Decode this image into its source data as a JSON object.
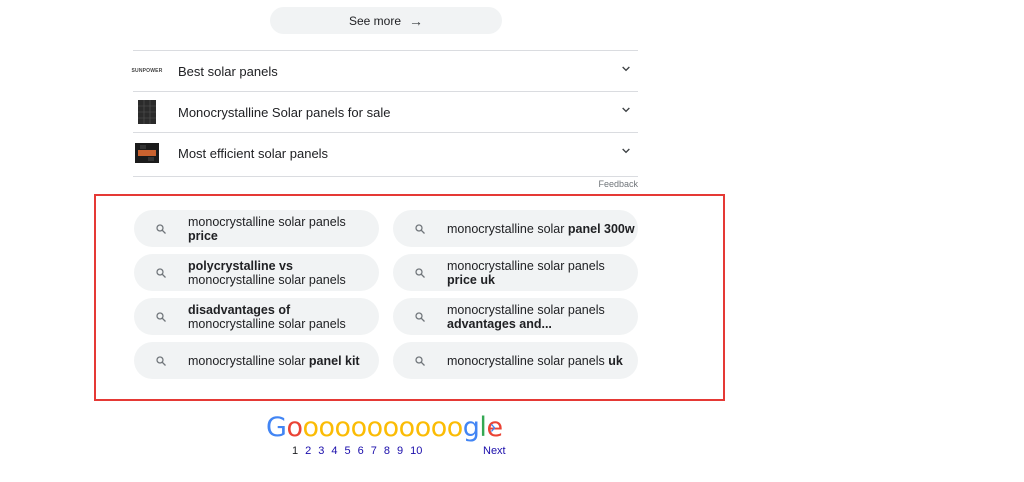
{
  "see_more": {
    "label": "See more",
    "arrow": "→"
  },
  "related_searches": [
    {
      "label": "Best solar panels",
      "thumb": "SUNPOWER",
      "icon": "sunpower-logo-icon"
    },
    {
      "label": "Monocrystalline Solar panels for sale",
      "icon": "solar-panel-thumb-icon"
    },
    {
      "label": "Most efficient solar panels",
      "icon": "solar-panel-efficient-thumb-icon"
    }
  ],
  "feedback": "Feedback",
  "suggestions": [
    {
      "normal": "monocrystalline solar panels ",
      "bold": "price"
    },
    {
      "normal": "monocrystalline solar ",
      "bold": "panel 300w"
    },
    {
      "bold": "polycrystalline vs",
      "normal": "monocrystalline solar panels"
    },
    {
      "normal": "monocrystalline solar panels ",
      "bold": "price uk"
    },
    {
      "bold": "disadvantages of",
      "normal": "monocrystalline solar panels"
    },
    {
      "normal": "monocrystalline solar panels ",
      "bold": "advantages and..."
    },
    {
      "normal": "monocrystalline solar ",
      "bold": "panel kit"
    },
    {
      "normal": "monocrystalline solar panels ",
      "bold": "uk"
    }
  ],
  "logo": {
    "letters": [
      "G",
      "o",
      "o",
      "o",
      "o",
      "o",
      "o",
      "o",
      "o",
      "o",
      "o",
      "o",
      "g",
      "l",
      "e"
    ],
    "colors": [
      "#4285f4",
      "#ea4335",
      "#fbbc05",
      "#fbbc05",
      "#fbbc05",
      "#fbbc05",
      "#fbbc05",
      "#fbbc05",
      "#fbbc05",
      "#fbbc05",
      "#fbbc05",
      "#fbbc05",
      "#4285f4",
      "#34a853",
      "#ea4335"
    ]
  },
  "pagination": {
    "pages": [
      "1",
      "2",
      "3",
      "4",
      "5",
      "6",
      "7",
      "8",
      "9",
      "10"
    ],
    "current": "1",
    "next_label": "Next",
    "next_chevron": "›"
  }
}
